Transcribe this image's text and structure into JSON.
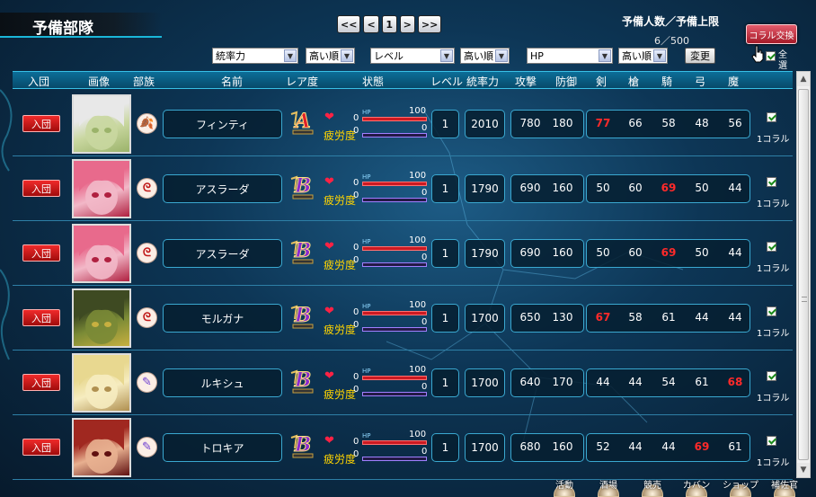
{
  "page": {
    "title": "予備部隊"
  },
  "pager": {
    "first": "<<",
    "prev": "<",
    "current": "1",
    "next": ">",
    "last": ">>"
  },
  "reserve": {
    "label": "予備人数／予備上限",
    "count": "6／500"
  },
  "coral_button": "コラル交換",
  "filters": {
    "sort1": "統率力",
    "order1": "高い順",
    "sort2": "レベル",
    "order2": "高い順",
    "sort3": "HP",
    "order3": "高い順",
    "change": "変更",
    "select_all": "全選択"
  },
  "headers": {
    "join": "入団",
    "image": "画像",
    "tribe": "部族",
    "name": "名前",
    "rarity": "レア度",
    "status": "状態",
    "level": "レベル",
    "command": "統率力",
    "attack": "攻撃",
    "defense": "防御",
    "sword": "剣",
    "spear": "槍",
    "cavalry": "騎",
    "bow": "弓",
    "magic": "魔"
  },
  "row_labels": {
    "join": "入団",
    "fatigue": "疲労度",
    "hp_tag": "HP",
    "coral": "1コラル",
    "hp_max": "100",
    "hp_min": "0",
    "fa_min": "0",
    "fa_max": "0"
  },
  "units": [
    {
      "name": "フィンティ",
      "rarity": "A",
      "tribe": "red-leaf",
      "level": "1",
      "command": "2010",
      "attack": "780",
      "defense": "180",
      "sword": "77",
      "spear": "66",
      "cavalry": "58",
      "bow": "48",
      "magic": "56",
      "highlight": "sword",
      "portrait": "silver-hair"
    },
    {
      "name": "アスラーダ",
      "rarity": "B",
      "tribe": "red-swirl",
      "level": "1",
      "command": "1790",
      "attack": "690",
      "defense": "160",
      "sword": "50",
      "spear": "60",
      "cavalry": "69",
      "bow": "50",
      "magic": "44",
      "highlight": "cavalry",
      "portrait": "pink-hair"
    },
    {
      "name": "アスラーダ",
      "rarity": "B",
      "tribe": "red-swirl",
      "level": "1",
      "command": "1790",
      "attack": "690",
      "defense": "160",
      "sword": "50",
      "spear": "60",
      "cavalry": "69",
      "bow": "50",
      "magic": "44",
      "highlight": "cavalry",
      "portrait": "pink-hair"
    },
    {
      "name": "モルガナ",
      "rarity": "B",
      "tribe": "red-swirl",
      "level": "1",
      "command": "1700",
      "attack": "650",
      "defense": "130",
      "sword": "67",
      "spear": "58",
      "cavalry": "61",
      "bow": "44",
      "magic": "44",
      "highlight": "sword",
      "portrait": "green-mask"
    },
    {
      "name": "ルキシュ",
      "rarity": "B",
      "tribe": "purple-feather",
      "level": "1",
      "command": "1700",
      "attack": "640",
      "defense": "170",
      "sword": "44",
      "spear": "44",
      "cavalry": "54",
      "bow": "61",
      "magic": "68",
      "highlight": "magic",
      "portrait": "blonde"
    },
    {
      "name": "トロキア",
      "rarity": "B",
      "tribe": "purple-feather",
      "level": "1",
      "command": "1700",
      "attack": "680",
      "defense": "160",
      "sword": "52",
      "spear": "44",
      "cavalry": "44",
      "bow": "69",
      "magic": "61",
      "highlight": "bow",
      "portrait": "red-hair"
    }
  ],
  "bottom_nav": [
    "活動",
    "酒場",
    "競売",
    "カバン",
    "ショップ",
    "補佐官"
  ],
  "colors": {
    "accent": "#1ab6d8",
    "highlight_stat": "#ff2a2a",
    "join": "#d01818",
    "rarity_a": "#e0202a",
    "rarity_b": "#8a2ad0"
  }
}
